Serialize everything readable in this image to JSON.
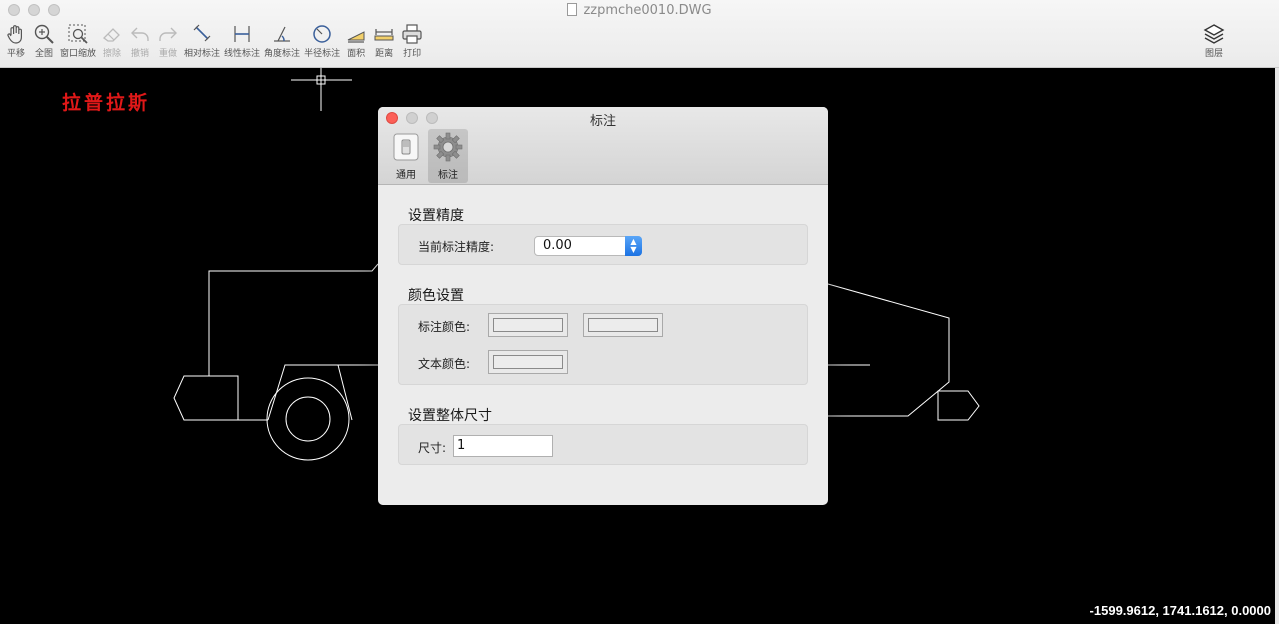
{
  "window": {
    "title": "zzpmche0010.DWG"
  },
  "toolbar": {
    "tools": [
      {
        "id": "pan",
        "label": "平移",
        "icon": "hand-icon",
        "enabled": true
      },
      {
        "id": "full",
        "label": "全图",
        "icon": "zoom-extents-icon",
        "enabled": true
      },
      {
        "id": "window-zoom",
        "label": "窗口缩放",
        "icon": "zoom-window-icon",
        "enabled": true
      },
      {
        "id": "erase",
        "label": "擦除",
        "icon": "eraser-icon",
        "enabled": false
      },
      {
        "id": "undo",
        "label": "撤销",
        "icon": "undo-icon",
        "enabled": false
      },
      {
        "id": "redo",
        "label": "重做",
        "icon": "redo-icon",
        "enabled": false
      },
      {
        "id": "aligned-dim",
        "label": "相对标注",
        "icon": "aligned-dimension-icon",
        "enabled": true
      },
      {
        "id": "linear-dim",
        "label": "线性标注",
        "icon": "linear-dimension-icon",
        "enabled": true
      },
      {
        "id": "angle-dim",
        "label": "角度标注",
        "icon": "angle-dimension-icon",
        "enabled": true
      },
      {
        "id": "radius-dim",
        "label": "半径标注",
        "icon": "radius-dimension-icon",
        "enabled": true
      },
      {
        "id": "area",
        "label": "面积",
        "icon": "area-icon",
        "enabled": true
      },
      {
        "id": "distance",
        "label": "距离",
        "icon": "distance-icon",
        "enabled": true
      },
      {
        "id": "print",
        "label": "打印",
        "icon": "printer-icon",
        "enabled": true
      }
    ],
    "layers": {
      "label": "图层",
      "icon": "layers-icon"
    }
  },
  "canvas": {
    "watermark": "拉普拉斯",
    "coordinates": "-1599.9612, 1741.1612, 0.0000",
    "background": "#000000",
    "line_color": "#ffffff"
  },
  "dialog": {
    "title": "标注",
    "tabs": [
      {
        "label": "通用",
        "icon": "switch-icon",
        "active": false
      },
      {
        "label": "标注",
        "icon": "gear-icon",
        "active": true
      }
    ],
    "precision": {
      "section_title": "设置精度",
      "label": "当前标注精度:",
      "value": "0.00"
    },
    "colors": {
      "section_title": "颜色设置",
      "dim_color_label": "标注颜色:",
      "text_color_label": "文本颜色:"
    },
    "size": {
      "section_title": "设置整体尺寸",
      "label": "尺寸:",
      "value": "1"
    }
  }
}
